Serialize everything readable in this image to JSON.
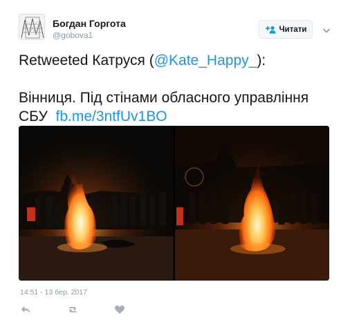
{
  "user": {
    "name": "Богдан Горгота",
    "handle": "@gobova1",
    "avatar_icon": "avatar-image"
  },
  "follow_button": {
    "label": "Читати",
    "icon": "add-user-icon"
  },
  "menu_icon": "chevron-down-icon",
  "tweet": {
    "line1_prefix": "Retweeted Катруся (",
    "mention": "@Kate_Happy_",
    "line1_suffix": "):",
    "line2": "Вінниця. Під стінами обласного управління",
    "line3_prefix": "СБУ  ",
    "link": "fb.me/3ntfUv1BO"
  },
  "media": {
    "photos": [
      "bonfire-photo-1",
      "bonfire-photo-2"
    ]
  },
  "timestamp": "14:51 - 13 бер. 2017",
  "actions": [
    "reply-icon",
    "retweet-icon",
    "like-icon"
  ],
  "colors": {
    "link": "#1b95e0",
    "muted": "#8899a6",
    "text": "#14171a"
  }
}
